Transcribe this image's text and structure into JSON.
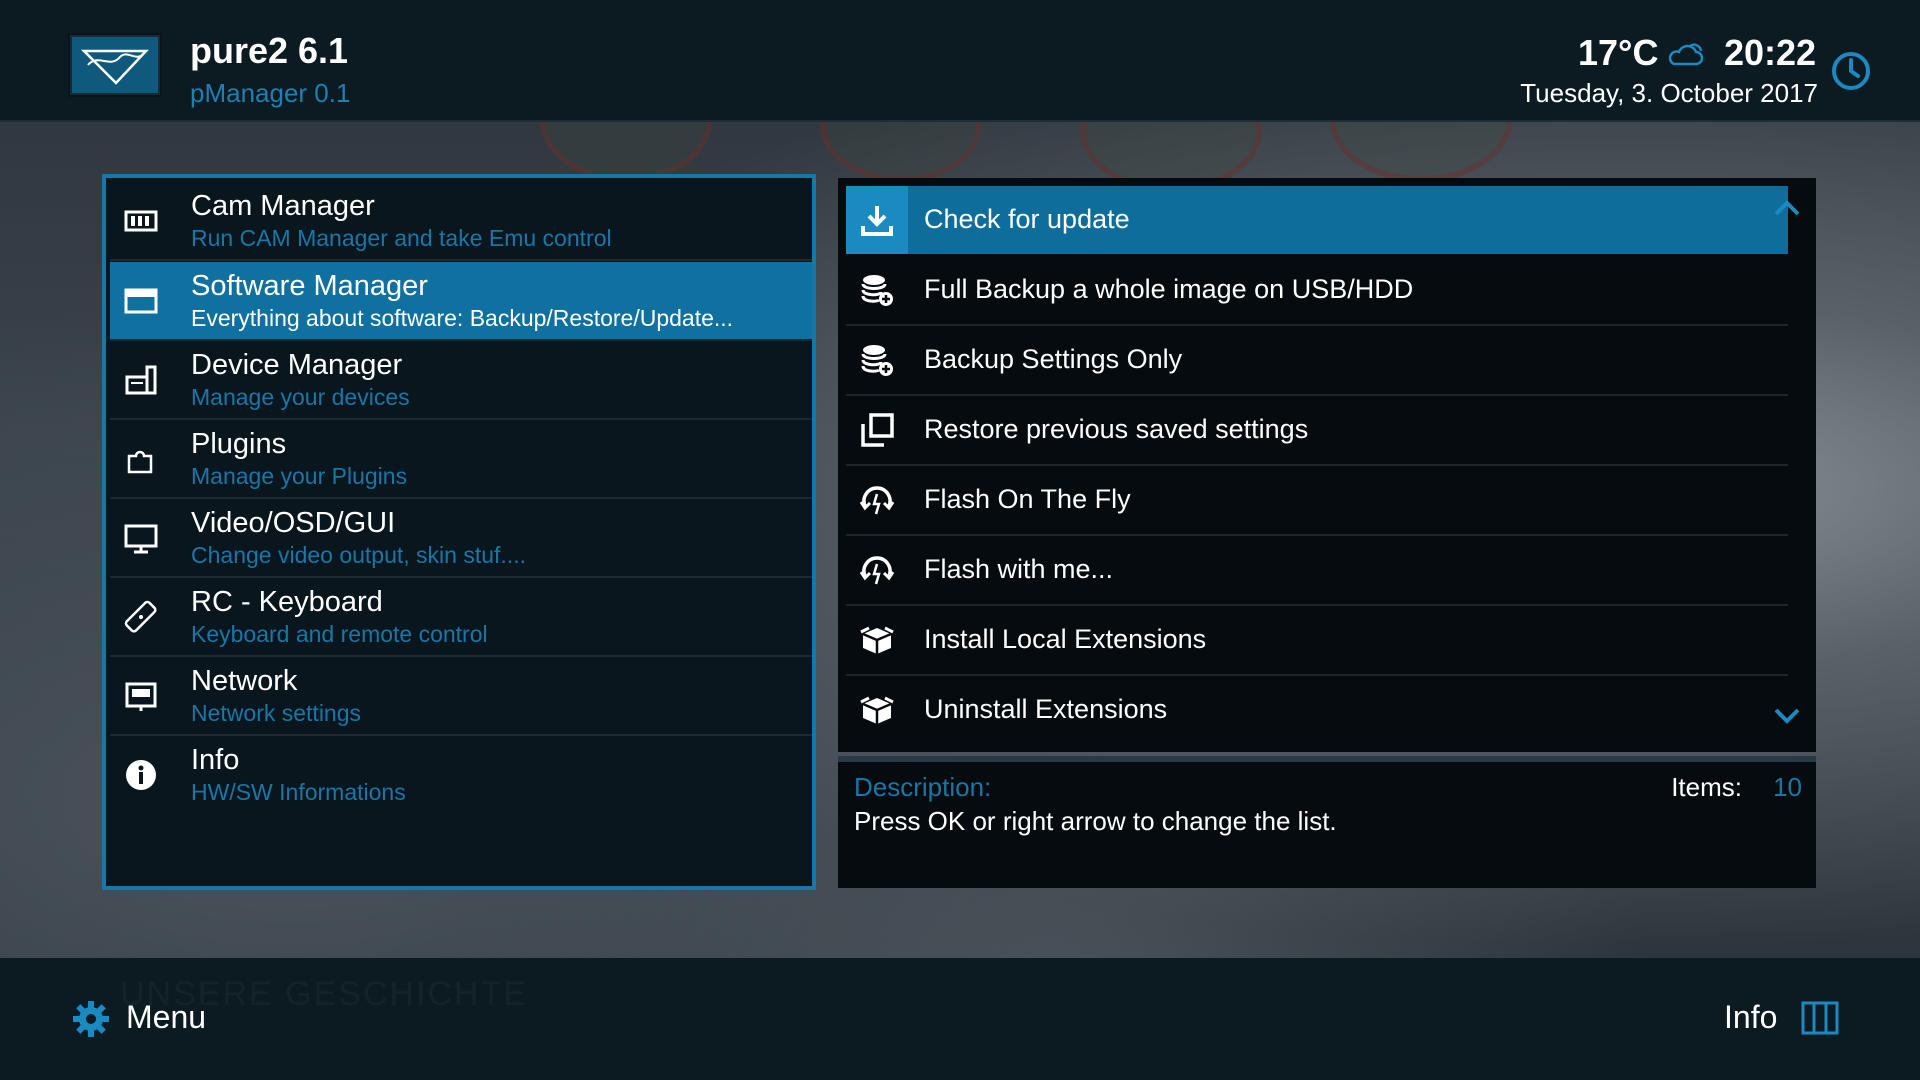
{
  "header": {
    "title": "pure2 6.1",
    "subtitle": "pManager 0.1",
    "temperature": "17°C",
    "time": "20:22",
    "date": "Tuesday,  3. October 2017",
    "weather_icon": "cloudy-icon",
    "clock_icon": "clock-icon"
  },
  "left_menu": {
    "selected_index": 1,
    "items": [
      {
        "title": "Cam Manager",
        "subtitle": "Run CAM Manager and take Emu control",
        "icon": "cam-icon"
      },
      {
        "title": "Software Manager",
        "subtitle": "Everything about software: Backup/Restore/Update...",
        "icon": "window-icon"
      },
      {
        "title": "Device Manager",
        "subtitle": "Manage your devices",
        "icon": "device-icon"
      },
      {
        "title": "Plugins",
        "subtitle": "Manage your Plugins",
        "icon": "puzzle-icon"
      },
      {
        "title": "Video/OSD/GUI",
        "subtitle": "Change video output, skin stuf....",
        "icon": "monitor-icon"
      },
      {
        "title": "RC - Keyboard",
        "subtitle": "Keyboard and remote control",
        "icon": "remote-icon"
      },
      {
        "title": "Network",
        "subtitle": "Network settings",
        "icon": "network-icon"
      },
      {
        "title": "Info",
        "subtitle": "HW/SW Informations",
        "icon": "info-icon"
      }
    ]
  },
  "right_list": {
    "selected_index": 0,
    "items": [
      {
        "label": "Check for update",
        "icon": "download-icon"
      },
      {
        "label": "Full Backup a whole image on USB/HDD",
        "icon": "database-add-icon"
      },
      {
        "label": "Backup Settings Only",
        "icon": "database-add-icon"
      },
      {
        "label": "Restore previous saved settings",
        "icon": "restore-icon"
      },
      {
        "label": "Flash On The Fly",
        "icon": "flash-icon"
      },
      {
        "label": "Flash with me...",
        "icon": "flash-icon"
      },
      {
        "label": "Install Local Extensions",
        "icon": "package-icon"
      },
      {
        "label": "Uninstall Extensions",
        "icon": "package-icon"
      }
    ],
    "scroll_up_icon": "chevron-up-icon",
    "scroll_down_icon": "chevron-down-icon"
  },
  "description": {
    "label": "Description:",
    "text": "Press OK or right arrow to change the list.",
    "items_label": "Items:",
    "items_count": "10"
  },
  "footer": {
    "menu_label": "Menu",
    "info_label": "Info",
    "watermark": "UNSERE GESCHICHTE"
  },
  "colors": {
    "accent": "#1070a0",
    "accent_light": "#1877a8",
    "panel_bg": "#0a161d",
    "header_bg": "#0c1a22"
  }
}
